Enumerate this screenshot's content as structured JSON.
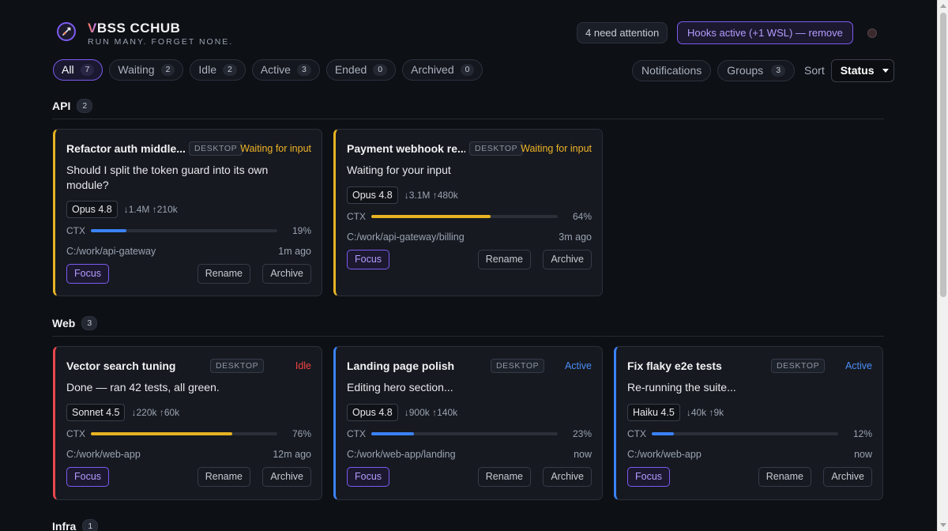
{
  "brand": {
    "title_first": "V",
    "title_rest": "BSS CCHUB",
    "tagline": "RUN MANY. FORGET NONE."
  },
  "header": {
    "attention": "4 need attention",
    "hooks": "Hooks active (+1 WSL) — remove"
  },
  "filters": [
    {
      "label": "All",
      "count": "7",
      "active": true
    },
    {
      "label": "Waiting",
      "count": "2"
    },
    {
      "label": "Idle",
      "count": "2"
    },
    {
      "label": "Active",
      "count": "3"
    },
    {
      "label": "Ended",
      "count": "0"
    },
    {
      "label": "Archived",
      "count": "0"
    }
  ],
  "controls": {
    "notifications": "Notifications",
    "groups": "Groups",
    "groups_count": "3",
    "sort_label": "Sort",
    "sort_value": "Status"
  },
  "colors": {
    "accent": "#7c5cf0",
    "waiting": "#e6b422",
    "idle": "#e5484d",
    "active": "#3b82f6"
  },
  "groups": [
    {
      "name": "API",
      "count": "2",
      "sessions": [
        {
          "title": "Refactor auth middle...",
          "source": "DESKTOP",
          "status": "Waiting for input",
          "state": "waiting",
          "message": "Should I split the token guard into its own module?",
          "model": "Opus 4.8",
          "tokens": "↓1.4M ↑210k",
          "ctx_label": "CTX",
          "ctx_percent": 19,
          "ctx_text": "19%",
          "ctx_color": "#3b82f6",
          "path": "C:/work/api-gateway",
          "ago": "1m ago",
          "focus": "Focus",
          "rename": "Rename",
          "archive": "Archive"
        },
        {
          "title": "Payment webhook re...",
          "source": "DESKTOP",
          "status": "Waiting for input",
          "state": "waiting",
          "message": "Waiting for your input",
          "model": "Opus 4.8",
          "tokens": "↓3.1M ↑480k",
          "ctx_label": "CTX",
          "ctx_percent": 64,
          "ctx_text": "64%",
          "ctx_color": "#e6b422",
          "path": "C:/work/api-gateway/billing",
          "ago": "3m ago",
          "focus": "Focus",
          "rename": "Rename",
          "archive": "Archive"
        }
      ]
    },
    {
      "name": "Web",
      "count": "3",
      "sessions": [
        {
          "title": "Vector search tuning",
          "source": "DESKTOP",
          "status": "Idle",
          "state": "idle",
          "message": "Done — ran 42 tests, all green.",
          "model": "Sonnet 4.5",
          "tokens": "↓220k ↑60k",
          "ctx_label": "CTX",
          "ctx_percent": 76,
          "ctx_text": "76%",
          "ctx_color": "#e6b422",
          "path": "C:/work/web-app",
          "ago": "12m ago",
          "focus": "Focus",
          "rename": "Rename",
          "archive": "Archive"
        },
        {
          "title": "Landing page polish",
          "source": "DESKTOP",
          "status": "Active",
          "state": "active",
          "message": "Editing hero section...",
          "model": "Opus 4.8",
          "tokens": "↓900k ↑140k",
          "ctx_label": "CTX",
          "ctx_percent": 23,
          "ctx_text": "23%",
          "ctx_color": "#3b82f6",
          "path": "C:/work/web-app/landing",
          "ago": "now",
          "focus": "Focus",
          "rename": "Rename",
          "archive": "Archive"
        },
        {
          "title": "Fix flaky e2e tests",
          "source": "DESKTOP",
          "status": "Active",
          "state": "active",
          "message": "Re-running the suite...",
          "model": "Haiku 4.5",
          "tokens": "↓40k ↑9k",
          "ctx_label": "CTX",
          "ctx_percent": 12,
          "ctx_text": "12%",
          "ctx_color": "#3b82f6",
          "path": "C:/work/web-app",
          "ago": "now",
          "focus": "Focus",
          "rename": "Rename",
          "archive": "Archive"
        }
      ]
    },
    {
      "name": "Infra",
      "count": "1",
      "sessions": []
    }
  ]
}
